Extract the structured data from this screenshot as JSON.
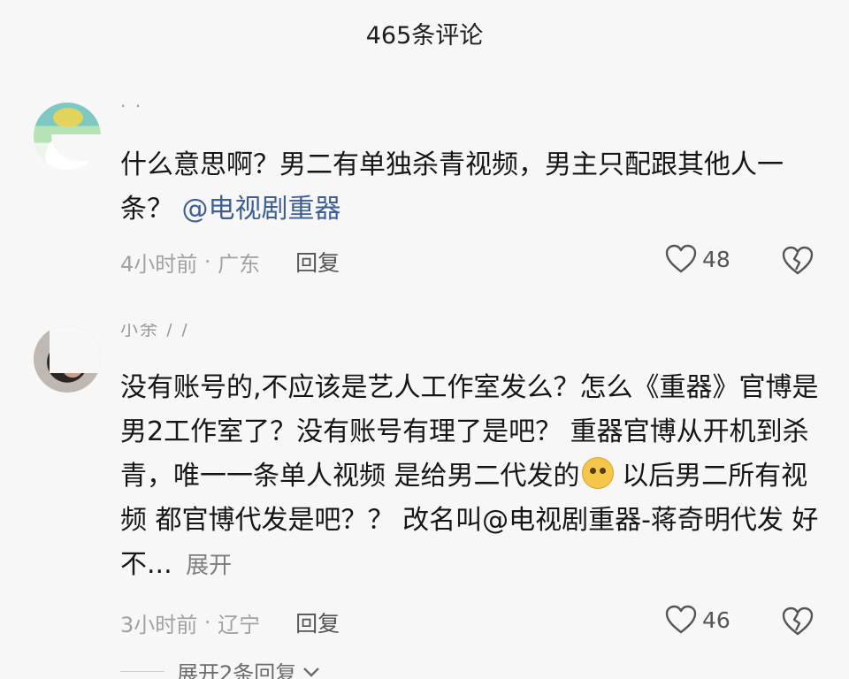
{
  "header": {
    "title": "465条评论"
  },
  "comments": [
    {
      "username": "· ·",
      "text_before": "什么意思啊？男二有单独杀青视频，男主只配跟其他人一条？",
      "mention": "@电视剧重器",
      "time": "4小时前",
      "location": "广东",
      "reply_label": "回复",
      "likes": "48"
    },
    {
      "username": "小余 / /",
      "text": "没有账号的,不应该是艺人工作室发么？怎么《重器》官博是男2工作室了？没有账号有理了是吧？ 重器官博从开机到杀青，唯一一条单人视频 是给男二代发的",
      "text_after": "以后男二所有视频 都官博代发是吧？？ 改名叫@电视剧重器-蒋奇明代发  好不...",
      "expand_label": "展开",
      "time": "3小时前",
      "location": "辽宁",
      "reply_label": "回复",
      "likes": "46"
    }
  ],
  "expand_replies_label": "展开2条回复",
  "icons": {
    "like": "heart-outline-icon",
    "dislike": "broken-heart-icon",
    "emoji": "thinking-face-emoji",
    "chevron": "chevron-down-icon"
  },
  "colors": {
    "background": "#f7f7f7",
    "text": "#161616",
    "meta": "#a1a1a1",
    "mention": "#3d5f95"
  }
}
